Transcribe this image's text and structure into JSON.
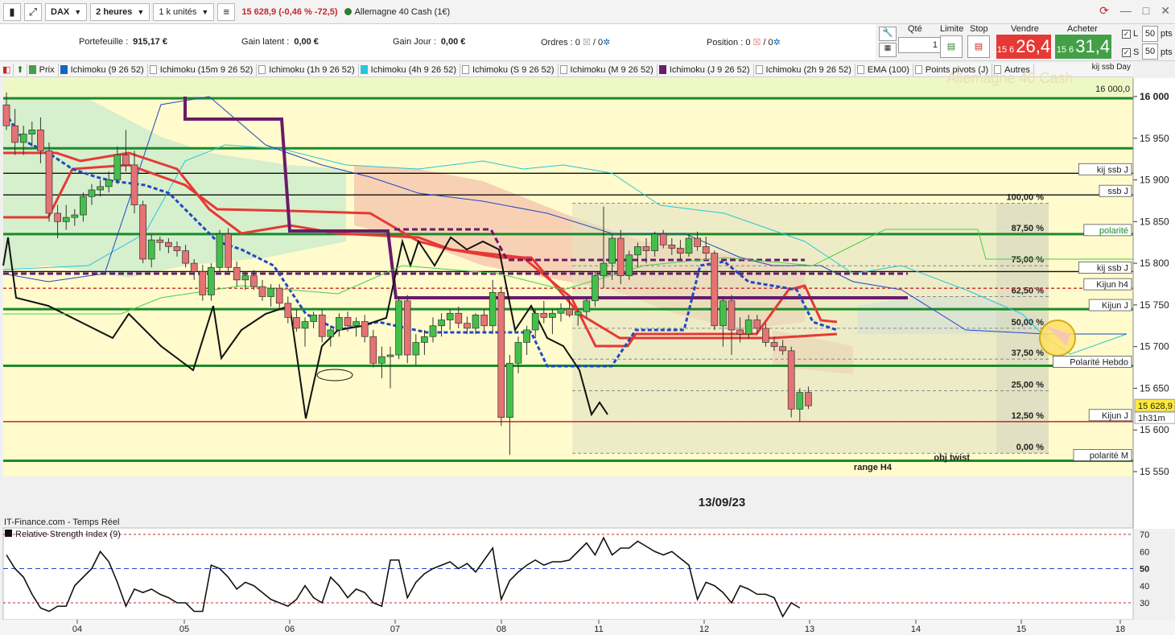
{
  "toolbar": {
    "instrument": "DAX",
    "timeframe": "2 heures",
    "units": "1 k unités",
    "quote": "15 628,9 (-0,46 % -72,5)",
    "market": "Allemagne 40 Cash (1€)"
  },
  "info": {
    "portefeuille_label": "Portefeuille :",
    "portefeuille_value": "915,17 €",
    "gain_latent_label": "Gain latent :",
    "gain_latent_value": "0,00 €",
    "gain_jour_label": "Gain Jour :",
    "gain_jour_value": "0,00 €",
    "ordres_label": "Ordres :",
    "ordres_a": "0",
    "ordres_b": "0",
    "position_label": "Position :",
    "position_a": "0",
    "position_b": "0"
  },
  "order": {
    "qte_label": "Qté",
    "qte_value": "1",
    "limite_label": "Limite",
    "stop_label": "Stop",
    "vendre_label": "Vendre",
    "vendre_small": "15 6",
    "vendre_big": "26,4",
    "acheter_label": "Acheter",
    "acheter_small": "15 6",
    "acheter_big": "31,4",
    "l_label": "L",
    "l_value": "50",
    "s_label": "S",
    "s_value": "50",
    "pts": "pts"
  },
  "indicators": [
    {
      "label": "Prix",
      "color": "#43a047"
    },
    {
      "label": "Ichimoku (9 26 52)",
      "color": "#1565c0"
    },
    {
      "label": "Ichimoku (15m 9 26 52)",
      "color": ""
    },
    {
      "label": "Ichimoku (1h 9 26 52)",
      "color": ""
    },
    {
      "label": "Ichimoku (4h 9 26 52)",
      "color": "#26c6da"
    },
    {
      "label": "Ichimoku (S 9 26 52)",
      "color": ""
    },
    {
      "label": "Ichimoku (M 9 26 52)",
      "color": ""
    },
    {
      "label": "Ichimoku (J 9 26 52)",
      "color": "#6a1b6a"
    },
    {
      "label": "Ichimoku (2h 9 26 52)",
      "color": ""
    },
    {
      "label": "EMA (100)",
      "color": ""
    },
    {
      "label": "Points pivots (J)",
      "color": ""
    },
    {
      "label": "Autres",
      "color": ""
    }
  ],
  "day_label": "kij ssb Day",
  "watermark": "Allemagne 40 Cash",
  "price_axis": {
    "ticks": [
      "16 000",
      "15 950",
      "15 900",
      "15 850",
      "15 800",
      "15 750",
      "15 700",
      "15 650",
      "15 600",
      "15 550"
    ],
    "current": "15 628,9",
    "timer": "1h31m"
  },
  "level_labels": [
    {
      "text": "16 000,0",
      "price": 16000
    },
    {
      "text": "kij ssb J",
      "price": 15908
    },
    {
      "text": "ssb J",
      "price": 15882
    },
    {
      "text": "polarité",
      "price": 15835
    },
    {
      "text": "kij ssb J",
      "price": 15790
    },
    {
      "text": "Kijun h4",
      "price": 15770
    },
    {
      "text": "Kijun J",
      "price": 15745
    },
    {
      "text": "Polarité Hebdo",
      "price": 15677
    },
    {
      "text": "Kijun J",
      "price": 15613
    },
    {
      "text": "polarité M",
      "price": 15565
    }
  ],
  "fib": [
    {
      "label": "100,00 %",
      "price": 15872
    },
    {
      "label": "87,50 %",
      "price": 15835
    },
    {
      "label": "75,00 %",
      "price": 15797
    },
    {
      "label": "62,50 %",
      "price": 15760
    },
    {
      "label": "50,00 %",
      "price": 15722
    },
    {
      "label": "37,50 %",
      "price": 15685
    },
    {
      "label": "25,00 %",
      "price": 15647
    },
    {
      "label": "12,50 %",
      "price": 15610
    },
    {
      "label": "0,00 %",
      "price": 15572
    }
  ],
  "annotations": {
    "obj_twist": "obj twist",
    "range": "range H4",
    "date": "13/09/23"
  },
  "footer_source": "IT-Finance.com - Temps Réel",
  "rsi": {
    "label": "Relative Strength Index (9)",
    "ticks": [
      "70",
      "60",
      "50",
      "40",
      "30"
    ]
  },
  "x_axis": [
    "04",
    "05",
    "06",
    "07",
    "08",
    "11",
    "12",
    "13",
    "14",
    "15",
    "18"
  ],
  "chart_data": {
    "type": "candlestick",
    "title": "DAX",
    "ylim": [
      15535,
      16015
    ],
    "candles": [
      {
        "o": 15990,
        "h": 16005,
        "l": 15960,
        "c": 15965
      },
      {
        "o": 15965,
        "h": 15985,
        "l": 15930,
        "c": 15945
      },
      {
        "o": 15945,
        "h": 15965,
        "l": 15930,
        "c": 15955
      },
      {
        "o": 15955,
        "h": 15970,
        "l": 15940,
        "c": 15960
      },
      {
        "o": 15960,
        "h": 15975,
        "l": 15920,
        "c": 15935
      },
      {
        "o": 15935,
        "h": 15945,
        "l": 15850,
        "c": 15860
      },
      {
        "o": 15860,
        "h": 15870,
        "l": 15830,
        "c": 15850
      },
      {
        "o": 15850,
        "h": 15870,
        "l": 15840,
        "c": 15855
      },
      {
        "o": 15855,
        "h": 15865,
        "l": 15845,
        "c": 15858
      },
      {
        "o": 15858,
        "h": 15885,
        "l": 15850,
        "c": 15880
      },
      {
        "o": 15880,
        "h": 15895,
        "l": 15870,
        "c": 15888
      },
      {
        "o": 15888,
        "h": 15900,
        "l": 15880,
        "c": 15892
      },
      {
        "o": 15892,
        "h": 15910,
        "l": 15885,
        "c": 15900
      },
      {
        "o": 15900,
        "h": 15940,
        "l": 15895,
        "c": 15930
      },
      {
        "o": 15930,
        "h": 15960,
        "l": 15910,
        "c": 15918
      },
      {
        "o": 15918,
        "h": 15935,
        "l": 15860,
        "c": 15870
      },
      {
        "o": 15870,
        "h": 15875,
        "l": 15800,
        "c": 15805
      },
      {
        "o": 15805,
        "h": 15835,
        "l": 15795,
        "c": 15828
      },
      {
        "o": 15828,
        "h": 15832,
        "l": 15815,
        "c": 15825
      },
      {
        "o": 15825,
        "h": 15830,
        "l": 15812,
        "c": 15820
      },
      {
        "o": 15820,
        "h": 15826,
        "l": 15808,
        "c": 15815
      },
      {
        "o": 15815,
        "h": 15822,
        "l": 15795,
        "c": 15800
      },
      {
        "o": 15800,
        "h": 15805,
        "l": 15780,
        "c": 15790
      },
      {
        "o": 15790,
        "h": 15798,
        "l": 15755,
        "c": 15762
      },
      {
        "o": 15762,
        "h": 15800,
        "l": 15755,
        "c": 15795
      },
      {
        "o": 15795,
        "h": 15840,
        "l": 15790,
        "c": 15835
      },
      {
        "o": 15835,
        "h": 15842,
        "l": 15790,
        "c": 15795
      },
      {
        "o": 15795,
        "h": 15802,
        "l": 15772,
        "c": 15780
      },
      {
        "o": 15780,
        "h": 15790,
        "l": 15768,
        "c": 15785
      },
      {
        "o": 15785,
        "h": 15792,
        "l": 15768,
        "c": 15772
      },
      {
        "o": 15772,
        "h": 15780,
        "l": 15755,
        "c": 15760
      },
      {
        "o": 15760,
        "h": 15775,
        "l": 15748,
        "c": 15770
      },
      {
        "o": 15770,
        "h": 15775,
        "l": 15745,
        "c": 15752
      },
      {
        "o": 15752,
        "h": 15760,
        "l": 15728,
        "c": 15735
      },
      {
        "o": 15735,
        "h": 15745,
        "l": 15718,
        "c": 15722
      },
      {
        "o": 15722,
        "h": 15735,
        "l": 15700,
        "c": 15730
      },
      {
        "o": 15730,
        "h": 15742,
        "l": 15722,
        "c": 15738
      },
      {
        "o": 15738,
        "h": 15745,
        "l": 15705,
        "c": 15712
      },
      {
        "o": 15712,
        "h": 15725,
        "l": 15700,
        "c": 15720
      },
      {
        "o": 15720,
        "h": 15740,
        "l": 15712,
        "c": 15735
      },
      {
        "o": 15735,
        "h": 15742,
        "l": 15718,
        "c": 15725
      },
      {
        "o": 15725,
        "h": 15735,
        "l": 15712,
        "c": 15730
      },
      {
        "o": 15730,
        "h": 15738,
        "l": 15705,
        "c": 15712
      },
      {
        "o": 15712,
        "h": 15720,
        "l": 15675,
        "c": 15680
      },
      {
        "o": 15680,
        "h": 15700,
        "l": 15662,
        "c": 15688
      },
      {
        "o": 15688,
        "h": 15700,
        "l": 15650,
        "c": 15690
      },
      {
        "o": 15690,
        "h": 15760,
        "l": 15685,
        "c": 15755
      },
      {
        "o": 15755,
        "h": 15762,
        "l": 15680,
        "c": 15690
      },
      {
        "o": 15690,
        "h": 15715,
        "l": 15678,
        "c": 15705
      },
      {
        "o": 15705,
        "h": 15720,
        "l": 15690,
        "c": 15712
      },
      {
        "o": 15712,
        "h": 15735,
        "l": 15705,
        "c": 15725
      },
      {
        "o": 15725,
        "h": 15740,
        "l": 15712,
        "c": 15732
      },
      {
        "o": 15732,
        "h": 15745,
        "l": 15720,
        "c": 15740
      },
      {
        "o": 15740,
        "h": 15748,
        "l": 15722,
        "c": 15728
      },
      {
        "o": 15728,
        "h": 15736,
        "l": 15715,
        "c": 15722
      },
      {
        "o": 15722,
        "h": 15740,
        "l": 15715,
        "c": 15738
      },
      {
        "o": 15738,
        "h": 15745,
        "l": 15718,
        "c": 15725
      },
      {
        "o": 15725,
        "h": 15780,
        "l": 15715,
        "c": 15765
      },
      {
        "o": 15765,
        "h": 15772,
        "l": 15605,
        "c": 15615
      },
      {
        "o": 15615,
        "h": 15690,
        "l": 15570,
        "c": 15680
      },
      {
        "o": 15680,
        "h": 15712,
        "l": 15668,
        "c": 15705
      },
      {
        "o": 15705,
        "h": 15725,
        "l": 15690,
        "c": 15720
      },
      {
        "o": 15720,
        "h": 15745,
        "l": 15710,
        "c": 15740
      },
      {
        "o": 15740,
        "h": 15755,
        "l": 15728,
        "c": 15735
      },
      {
        "o": 15735,
        "h": 15745,
        "l": 15715,
        "c": 15740
      },
      {
        "o": 15740,
        "h": 15752,
        "l": 15730,
        "c": 15745
      },
      {
        "o": 15745,
        "h": 15760,
        "l": 15735,
        "c": 15738
      },
      {
        "o": 15738,
        "h": 15745,
        "l": 15725,
        "c": 15742
      },
      {
        "o": 15742,
        "h": 15760,
        "l": 15735,
        "c": 15755
      },
      {
        "o": 15755,
        "h": 15790,
        "l": 15748,
        "c": 15785
      },
      {
        "o": 15785,
        "h": 15868,
        "l": 15770,
        "c": 15800
      },
      {
        "o": 15800,
        "h": 15835,
        "l": 15780,
        "c": 15830
      },
      {
        "o": 15830,
        "h": 15840,
        "l": 15775,
        "c": 15785
      },
      {
        "o": 15785,
        "h": 15815,
        "l": 15780,
        "c": 15810
      },
      {
        "o": 15810,
        "h": 15825,
        "l": 15795,
        "c": 15820
      },
      {
        "o": 15820,
        "h": 15830,
        "l": 15800,
        "c": 15815
      },
      {
        "o": 15815,
        "h": 15838,
        "l": 15808,
        "c": 15835
      },
      {
        "o": 15835,
        "h": 15840,
        "l": 15818,
        "c": 15822
      },
      {
        "o": 15822,
        "h": 15830,
        "l": 15810,
        "c": 15818
      },
      {
        "o": 15818,
        "h": 15828,
        "l": 15805,
        "c": 15812
      },
      {
        "o": 15812,
        "h": 15835,
        "l": 15808,
        "c": 15830
      },
      {
        "o": 15830,
        "h": 15838,
        "l": 15815,
        "c": 15820
      },
      {
        "o": 15820,
        "h": 15832,
        "l": 15805,
        "c": 15812
      },
      {
        "o": 15812,
        "h": 15815,
        "l": 15720,
        "c": 15725
      },
      {
        "o": 15725,
        "h": 15760,
        "l": 15700,
        "c": 15755
      },
      {
        "o": 15755,
        "h": 15762,
        "l": 15690,
        "c": 15720
      },
      {
        "o": 15720,
        "h": 15735,
        "l": 15705,
        "c": 15715
      },
      {
        "o": 15715,
        "h": 15738,
        "l": 15710,
        "c": 15732
      },
      {
        "o": 15732,
        "h": 15738,
        "l": 15715,
        "c": 15722
      },
      {
        "o": 15722,
        "h": 15728,
        "l": 15700,
        "c": 15705
      },
      {
        "o": 15705,
        "h": 15712,
        "l": 15695,
        "c": 15700
      },
      {
        "o": 15700,
        "h": 15708,
        "l": 15690,
        "c": 15695
      },
      {
        "o": 15695,
        "h": 15700,
        "l": 15615,
        "c": 15625
      },
      {
        "o": 15625,
        "h": 15650,
        "l": 15610,
        "c": 15645
      },
      {
        "o": 15645,
        "h": 15652,
        "l": 15625,
        "c": 15629
      }
    ],
    "rsi_values": [
      58,
      50,
      45,
      35,
      27,
      25,
      28,
      28,
      40,
      45,
      50,
      60,
      54,
      42,
      28,
      38,
      36,
      38,
      35,
      33,
      30,
      30,
      25,
      25,
      52,
      50,
      45,
      38,
      42,
      40,
      36,
      32,
      30,
      28,
      32,
      40,
      33,
      30,
      45,
      40,
      33,
      38,
      36,
      30,
      28,
      55,
      55,
      33,
      42,
      47,
      50,
      52,
      54,
      50,
      53,
      48,
      55,
      62,
      32,
      43,
      48,
      52,
      55,
      52,
      54,
      54,
      55,
      60,
      65,
      58,
      68,
      58,
      62,
      62,
      66,
      63,
      60,
      58,
      60,
      56,
      52,
      32,
      42,
      40,
      36,
      30,
      40,
      38,
      35,
      35,
      33,
      22,
      30,
      27
    ]
  }
}
